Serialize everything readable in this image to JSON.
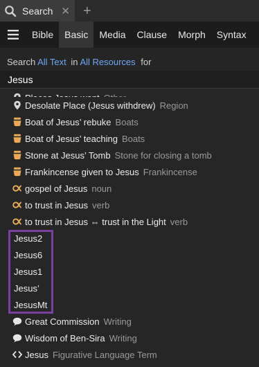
{
  "tab": {
    "title": "Search",
    "close_glyph": "✕",
    "new_glyph": "+"
  },
  "nav": {
    "tabs": [
      "Bible",
      "Basic",
      "Media",
      "Clause",
      "Morph",
      "Syntax"
    ],
    "active": "Basic"
  },
  "search_line": {
    "prefix": "Search",
    "scope": "All Text",
    "in_word": "in",
    "resources": "All Resources",
    "for_word": "for"
  },
  "query": {
    "value": "Jesus"
  },
  "results": [
    {
      "icon": "pin-icon",
      "label": "Places Jesus went",
      "meta": "Other"
    },
    {
      "icon": "pin-icon",
      "label": "Desolate Place (Jesus withdrew)",
      "meta": "Region"
    },
    {
      "icon": "object-icon",
      "label": "Boat of Jesus’ rebuke",
      "meta": "Boats"
    },
    {
      "icon": "object-icon",
      "label": "Boat of Jesus’ teaching",
      "meta": "Boats"
    },
    {
      "icon": "object-icon",
      "label": "Stone at Jesus’ Tomb",
      "meta": "Stone for closing a tomb"
    },
    {
      "icon": "object-icon",
      "label": "Frankincense given to Jesus",
      "meta": "Frankincense"
    },
    {
      "icon": "sense-icon",
      "label": "gospel of Jesus",
      "meta": "noun"
    },
    {
      "icon": "sense-icon",
      "label": "to trust in Jesus",
      "meta": "verb"
    },
    {
      "icon": "sense-icon",
      "label": "to trust in Jesus ⇔ trust in the Light",
      "meta": "verb"
    },
    {
      "icon": "",
      "label": "Jesus2",
      "meta": ""
    },
    {
      "icon": "",
      "label": "Jesus6",
      "meta": ""
    },
    {
      "icon": "",
      "label": "Jesus1",
      "meta": ""
    },
    {
      "icon": "",
      "label": "Jesus’",
      "meta": ""
    },
    {
      "icon": "",
      "label": "JesusMt",
      "meta": ""
    },
    {
      "icon": "speech-icon",
      "label": "Great Commission",
      "meta": "Writing"
    },
    {
      "icon": "speech-icon",
      "label": "Wisdom of Ben-Sira",
      "meta": "Writing"
    },
    {
      "icon": "code-icon",
      "label": "Jesus",
      "meta": "Figurative Language Term"
    }
  ],
  "colors": {
    "link": "#6fa8f5",
    "highlight": "#7b3fa0",
    "object_icon": "#e8a95a"
  }
}
